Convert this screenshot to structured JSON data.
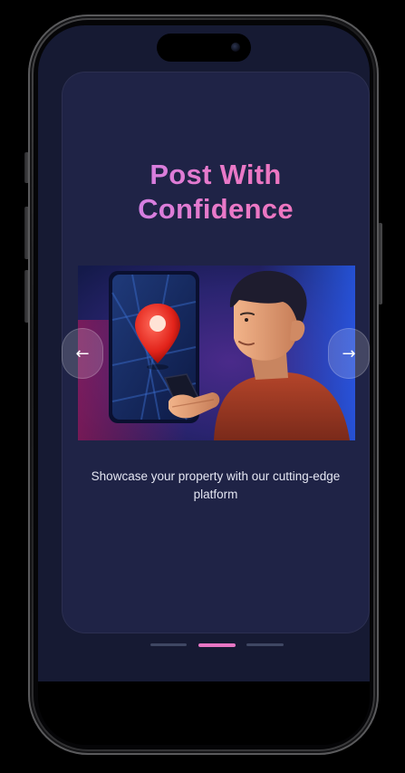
{
  "onboarding": {
    "title_line1": "Post With",
    "title_line2": "Confidence",
    "description": "Showcase your property with our cutting-edge platform",
    "prev_icon": "←",
    "next_icon": "→",
    "current_step": 2,
    "total_steps": 3
  },
  "hero": {
    "icon": "map-pin-icon",
    "illustration": "person-holding-phone-with-map"
  },
  "colors": {
    "background": "#161a33",
    "card": "#1f2346",
    "title_gradient_start": "#c084fc",
    "title_gradient_end": "#f472b6",
    "active_dot": "#e776c4",
    "inactive_dot": "#3f4763"
  }
}
